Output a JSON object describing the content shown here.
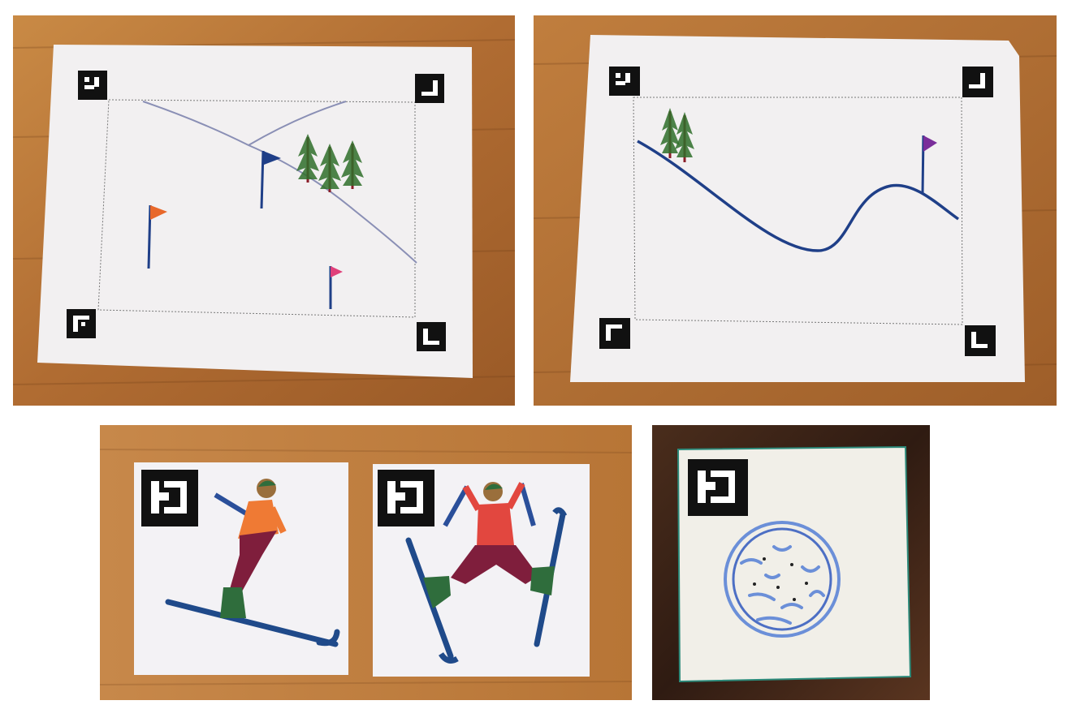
{
  "figure": {
    "panels": [
      {
        "id": "ski-slope-map-topview",
        "contents": [
          "slope-lines",
          "three-pine-trees",
          "blue-flag",
          "orange-flag",
          "pink-flag",
          "four-fiducial-markers"
        ]
      },
      {
        "id": "ski-slope-map-sideview",
        "contents": [
          "hill-profile-curve",
          "two-pine-trees",
          "purple-flag",
          "four-fiducial-markers"
        ]
      },
      {
        "id": "skier-cards",
        "contents": [
          "skiing-skier-card",
          "jumping-skier-card"
        ]
      },
      {
        "id": "snowball-card",
        "contents": [
          "snowball-drawing",
          "fiducial-marker"
        ]
      }
    ]
  },
  "colors": {
    "wood": "#b9773a",
    "wood_dark": "#3a2418",
    "paper": "#f2f0f1",
    "marker_black": "#111111",
    "ink_blue": "#1f3f88",
    "flag_orange": "#e8682a",
    "flag_pink": "#e0407a",
    "flag_purple": "#7a2e9a",
    "tree_green": "#2f6e2a",
    "trunk_red": "#8a1e28",
    "jacket_orange": "#ef7a34",
    "jacket_red": "#e2473f",
    "pants_maroon": "#7f1e3c",
    "boot_green": "#2f6d3c",
    "snowball_blue": "#6b8fd8"
  }
}
